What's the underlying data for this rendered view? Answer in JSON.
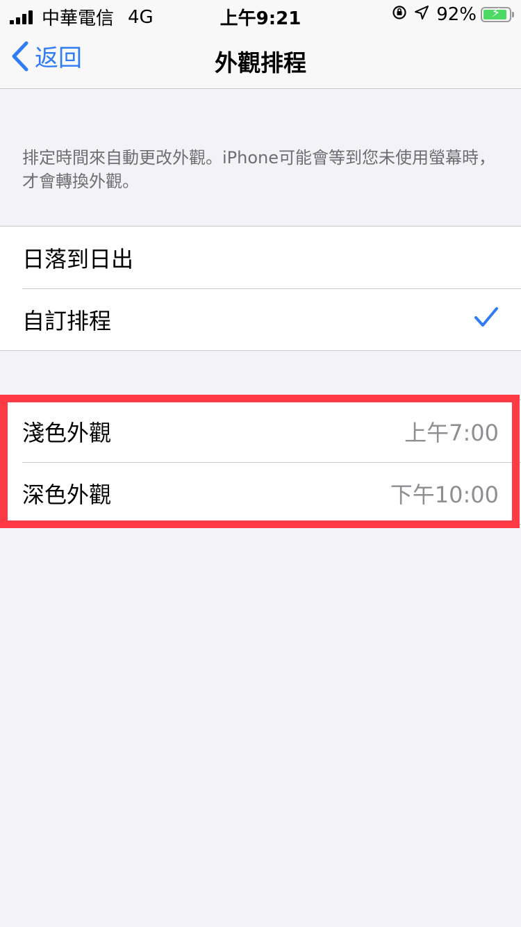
{
  "status_bar": {
    "carrier": "中華電信",
    "network": "4G",
    "time": "上午9:21",
    "battery_percent": "92%",
    "battery_level": 0.92
  },
  "nav": {
    "back_label": "返回",
    "title": "外觀排程"
  },
  "description": "排定時間來自動更改外觀。iPhone可能會等到您未使用螢幕時，才會轉換外觀。",
  "schedule_options": [
    {
      "label": "日落到日出",
      "selected": false
    },
    {
      "label": "自訂排程",
      "selected": true
    }
  ],
  "custom_schedule": {
    "light": {
      "label": "淺色外觀",
      "value": "上午7:00"
    },
    "dark": {
      "label": "深色外觀",
      "value": "下午10:00"
    }
  },
  "colors": {
    "accent": "#2f7cf6",
    "highlight": "#fe3b45",
    "battery": "#4cd964"
  }
}
